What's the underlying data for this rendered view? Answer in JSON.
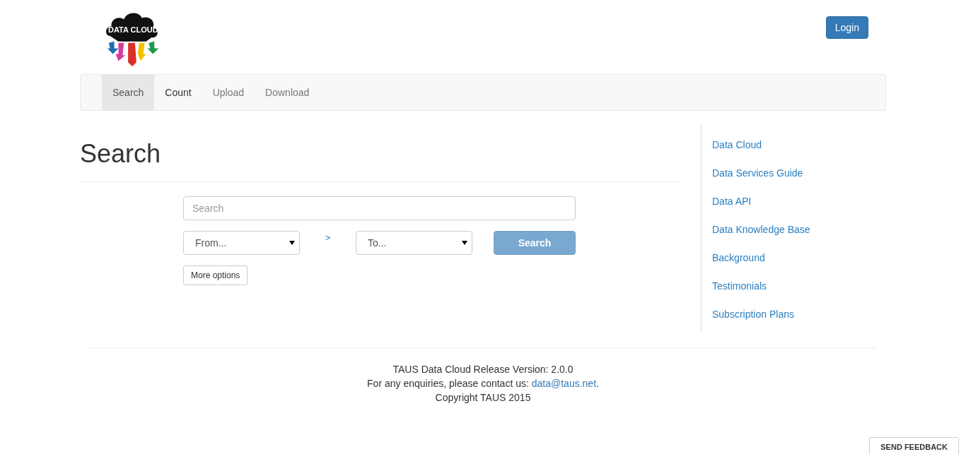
{
  "logo": {
    "text": "DATA CLOUD"
  },
  "login": {
    "label": "Login"
  },
  "tabs": [
    {
      "label": "Search",
      "selected": true,
      "hovered": false
    },
    {
      "label": "Count",
      "selected": false,
      "hovered": true
    },
    {
      "label": "Upload",
      "selected": false,
      "hovered": false
    },
    {
      "label": "Download",
      "selected": false,
      "hovered": false
    }
  ],
  "heading": "Search",
  "search": {
    "placeholder": "Search"
  },
  "from": {
    "value": "From..."
  },
  "separator": ">",
  "to": {
    "value": "To..."
  },
  "search_button": {
    "label": "Search",
    "disabled": true
  },
  "more_options": {
    "label": "More options"
  },
  "sidebar": {
    "items": [
      {
        "label": "Data Cloud"
      },
      {
        "label": "Data Services Guide"
      },
      {
        "label": "Data API"
      },
      {
        "label": "Data Knowledge Base"
      },
      {
        "label": "Background"
      },
      {
        "label": "Testimonials"
      },
      {
        "label": "Subscription Plans"
      }
    ]
  },
  "footer": {
    "version": "TAUS Data Cloud Release Version: 2.0.0",
    "contact_text": "For any enquiries, please contact us:",
    "contact_email": "data@taus.net",
    "contact_end": ".",
    "copyright": "Copyright TAUS 2015"
  },
  "feedback": {
    "label": "SEND FEEDBACK"
  }
}
